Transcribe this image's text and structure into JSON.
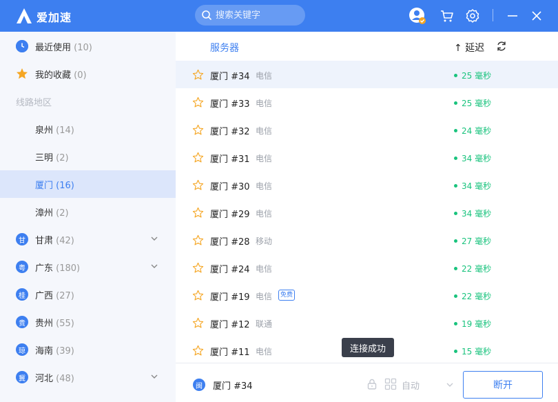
{
  "app": {
    "title": "爱加速"
  },
  "search": {
    "placeholder": "搜索关键字"
  },
  "sidebar": {
    "recent": {
      "label": "最近使用",
      "count": "(10)"
    },
    "favorites": {
      "label": "我的收藏",
      "count": "(0)"
    },
    "section_title": "线路地区",
    "cities": [
      {
        "label": "泉州",
        "count": "(14)"
      },
      {
        "label": "三明",
        "count": "(2)"
      },
      {
        "label": "厦门",
        "count": "(16)"
      },
      {
        "label": "漳州",
        "count": "(2)"
      }
    ],
    "provinces": [
      {
        "badge": "甘",
        "label": "甘肃",
        "count": "(42)"
      },
      {
        "badge": "粤",
        "label": "广东",
        "count": "(180)"
      },
      {
        "badge": "桂",
        "label": "广西",
        "count": "(27)"
      },
      {
        "badge": "贵",
        "label": "贵州",
        "count": "(55)"
      },
      {
        "badge": "琼",
        "label": "海南",
        "count": "(39)"
      },
      {
        "badge": "冀",
        "label": "河北",
        "count": "(48)"
      }
    ]
  },
  "list": {
    "col_server": "服务器",
    "col_latency": "↑ 延迟",
    "rows": [
      {
        "name": "厦门 #34",
        "isp": "电信",
        "latency": "25 毫秒"
      },
      {
        "name": "厦门 #33",
        "isp": "电信",
        "latency": "25 毫秒"
      },
      {
        "name": "厦门 #32",
        "isp": "电信",
        "latency": "24 毫秒"
      },
      {
        "name": "厦门 #31",
        "isp": "电信",
        "latency": "34 毫秒"
      },
      {
        "name": "厦门 #30",
        "isp": "电信",
        "latency": "34 毫秒"
      },
      {
        "name": "厦门 #29",
        "isp": "电信",
        "latency": "34 毫秒"
      },
      {
        "name": "厦门 #28",
        "isp": "移动",
        "latency": "27 毫秒"
      },
      {
        "name": "厦门 #24",
        "isp": "电信",
        "latency": "22 毫秒"
      },
      {
        "name": "厦门 #19",
        "isp": "电信",
        "latency": "22 毫秒",
        "badge": "免费"
      },
      {
        "name": "厦门 #12",
        "isp": "联通",
        "latency": "19 毫秒"
      },
      {
        "name": "厦门 #11",
        "isp": "电信",
        "latency": "15 毫秒"
      }
    ]
  },
  "tooltip": {
    "text": "连接成功"
  },
  "bottom": {
    "current_badge": "闽",
    "current_name": "厦门 #34",
    "mode_label": "自动",
    "disconnect_label": "断开"
  },
  "colors": {
    "accent": "#3d7ff0",
    "latency": "#19c37d",
    "star": "#f5a623"
  }
}
